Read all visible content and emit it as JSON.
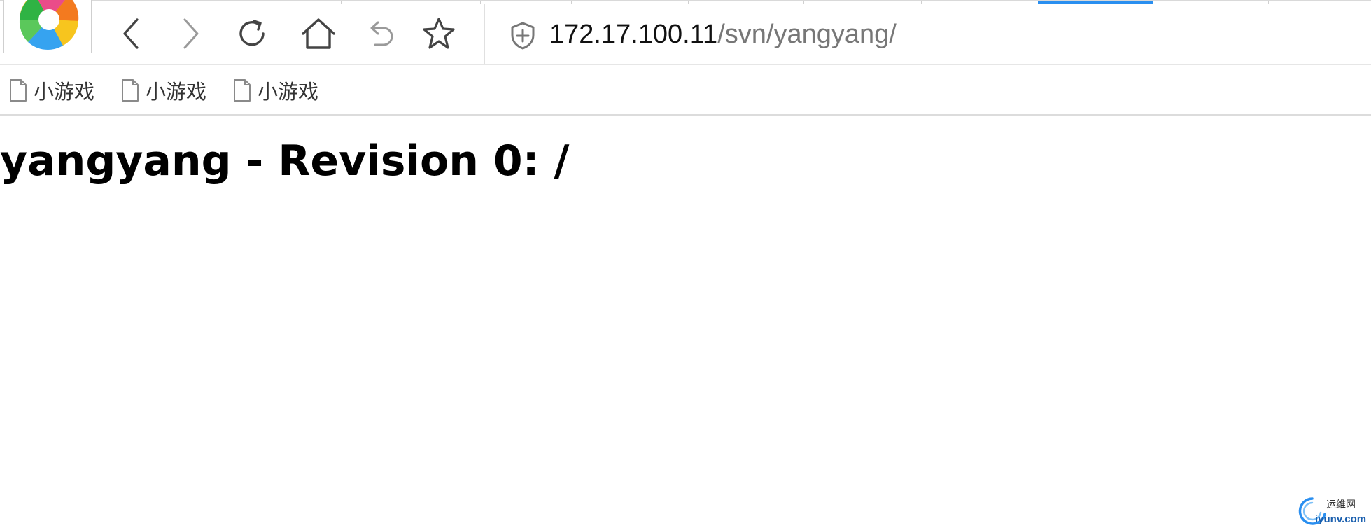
{
  "browser": {
    "logo_icon": "browser-logo-icon",
    "nav_icons": [
      "back-icon",
      "forward-icon",
      "reload-icon",
      "home-icon",
      "undo-close-tab-icon",
      "favorite-star-icon"
    ],
    "accent_color": "#2a8ff0"
  },
  "address_bar": {
    "host": "172.17.100.11",
    "path": "/svn/yangyang/",
    "security_icon": "shield-plus-icon"
  },
  "bookmarks": [
    {
      "label": "小游戏",
      "icon": "page-icon"
    },
    {
      "label": "小游戏",
      "icon": "page-icon"
    },
    {
      "label": "小游戏",
      "icon": "page-icon"
    }
  ],
  "page": {
    "heading": "yangyang - Revision 0: /"
  },
  "watermark": {
    "text_line1": "运维网",
    "text_line2": "iyunv.com"
  }
}
